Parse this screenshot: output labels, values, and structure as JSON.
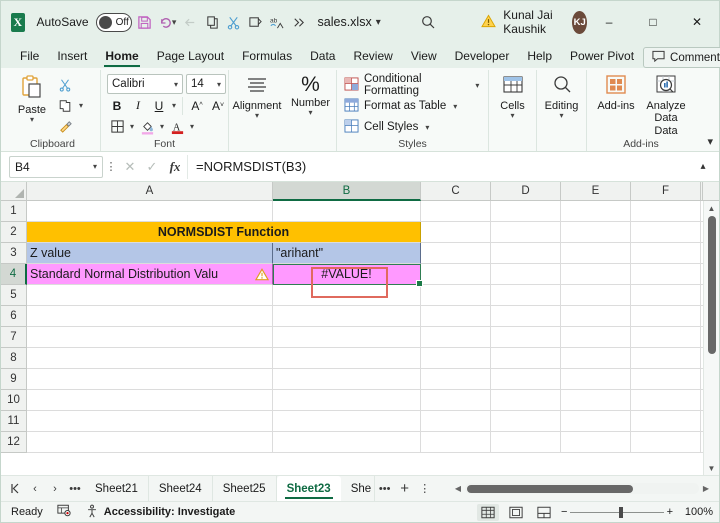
{
  "titlebar": {
    "app_icon": "excel-logo",
    "autosave_label": "AutoSave",
    "autosave_state": "Off",
    "quick_access": [
      "save-icon",
      "undo-icon",
      "undo-dropdown",
      "redo-icon",
      "copy-icon",
      "cut-icon",
      "paste-special-icon",
      "spelling-icon",
      "more-icon"
    ],
    "filename": "sales.xlsx",
    "search_icon": "search-icon",
    "warning_icon": "warning-icon",
    "account_name": "Kunal Jai Kaushik",
    "account_initials": "KJ",
    "minimize": "–",
    "maximize": "□",
    "close": "✕"
  },
  "ribbon_tabs": {
    "items": [
      {
        "label": "File",
        "active": false
      },
      {
        "label": "Insert",
        "active": false
      },
      {
        "label": "Home",
        "active": true
      },
      {
        "label": "Page Layout",
        "active": false
      },
      {
        "label": "Formulas",
        "active": false
      },
      {
        "label": "Data",
        "active": false
      },
      {
        "label": "Review",
        "active": false
      },
      {
        "label": "View",
        "active": false
      },
      {
        "label": "Developer",
        "active": false
      },
      {
        "label": "Help",
        "active": false
      },
      {
        "label": "Power Pivot",
        "active": false
      }
    ],
    "comments_label": "Comments",
    "share_label": "share-icon"
  },
  "ribbon": {
    "groups": [
      {
        "name": "Clipboard",
        "label": "Clipboard"
      },
      {
        "name": "Font",
        "label": "Font"
      },
      {
        "name": "Alignment",
        "label": ""
      },
      {
        "name": "Number",
        "label": ""
      },
      {
        "name": "Styles",
        "label": "Styles"
      },
      {
        "name": "Cells",
        "label": ""
      },
      {
        "name": "Editing",
        "label": ""
      },
      {
        "name": "Add-ins",
        "label": "Add-ins"
      }
    ],
    "paste_label": "Paste",
    "font_name": "Calibri",
    "font_size": "14",
    "bold": "B",
    "italic": "I",
    "underline": "U",
    "grow_font": "A",
    "shrink_font": "A",
    "alignment_label": "Alignment",
    "number_label": "Number",
    "conditional_formatting": "Conditional Formatting",
    "format_as_table": "Format as Table",
    "cell_styles": "Cell Styles",
    "cells_label": "Cells",
    "editing_label": "Editing",
    "addins_label": "Add-ins",
    "analyze_data_label": "Analyze Data",
    "analyze_data_line2": "Data"
  },
  "formula_bar": {
    "name_box": "B4",
    "cancel_icon": "✕",
    "enter_icon": "✓",
    "fx_icon": "fx",
    "formula": "=NORMSDIST(B3)",
    "expand_icon": "chevron-up-icon"
  },
  "grid": {
    "columns": [
      "A",
      "B",
      "C",
      "D",
      "E",
      "F"
    ],
    "selected_column": "B",
    "rows": [
      "1",
      "2",
      "3",
      "4",
      "5",
      "6",
      "7",
      "8",
      "9",
      "10",
      "11",
      "12"
    ],
    "selected_row": "4",
    "cells": {
      "A2": "NORMSDIST Function",
      "B3": "\"arihant\"",
      "A3": "Z value",
      "A4": "Standard Normal Distribution Valu",
      "B4": "#VALUE!"
    },
    "colors": {
      "title_fill": "#ffc000",
      "label_fill": "#b4c6e7",
      "result_fill": "#ff99ff",
      "selection_border": "#2f7d52",
      "error_border": "#e06a5e"
    }
  },
  "sheet_tabs": {
    "first_icon": "first-sheet-icon",
    "prev_icon": "‹",
    "next_icon": "›",
    "overflow_icon": "•••",
    "tabs": [
      {
        "label": "Sheet21",
        "active": false
      },
      {
        "label": "Sheet24",
        "active": false
      },
      {
        "label": "Sheet25",
        "active": false
      },
      {
        "label": "Sheet23",
        "active": true
      },
      {
        "label": "She",
        "active": false
      }
    ],
    "more_tabs": "•••",
    "add_sheet": "+",
    "menu_icon": "⋮"
  },
  "status_bar": {
    "mode": "Ready",
    "macro_icon": "record-macro-icon",
    "accessibility": "Accessibility: Investigate",
    "views": [
      "normal-view-icon",
      "page-layout-icon",
      "page-break-icon"
    ],
    "zoom_out": "−",
    "zoom_in": "+",
    "zoom_level": "100%"
  }
}
